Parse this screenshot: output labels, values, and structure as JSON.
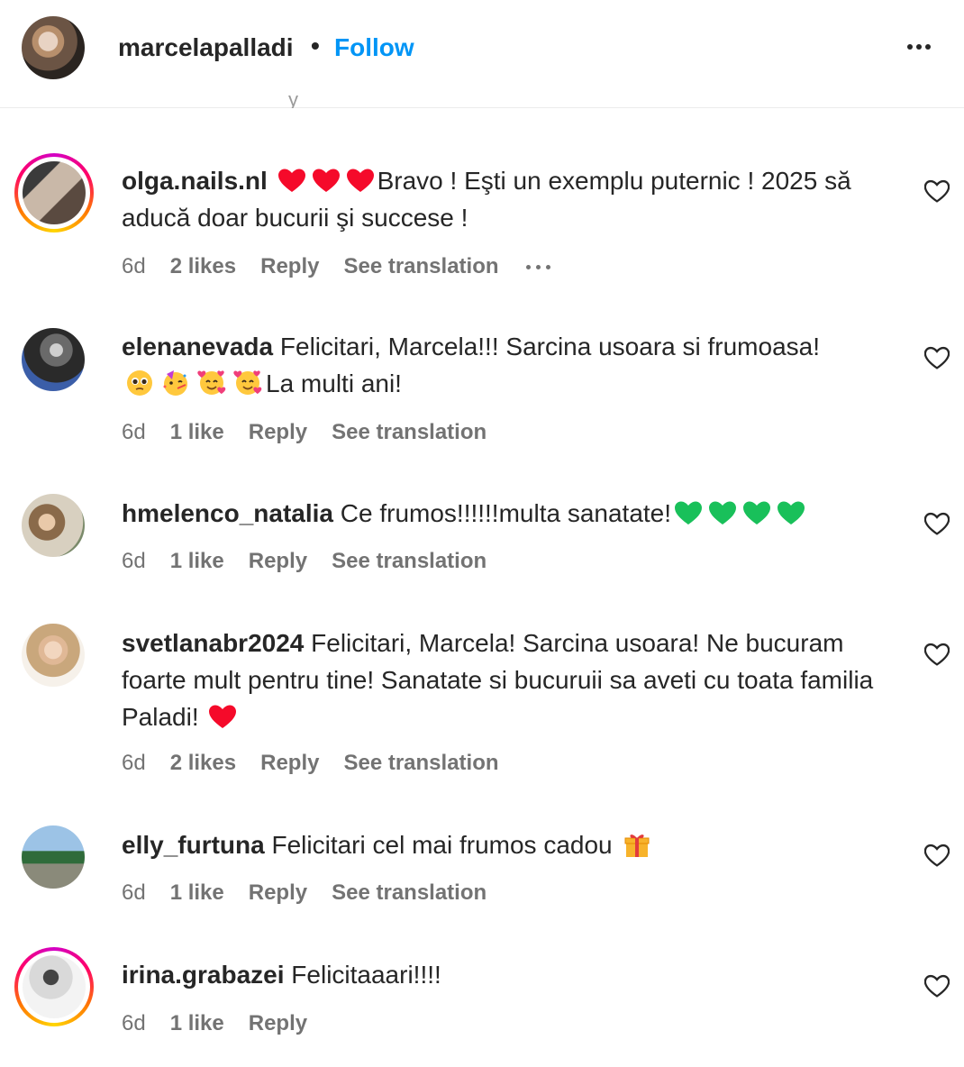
{
  "header": {
    "username": "marcelapalladi",
    "separator": "•",
    "follow_label": "Follow",
    "partial_text": "y"
  },
  "colors": {
    "link_blue": "#0095f6",
    "text_primary": "#262626",
    "text_secondary": "#737373",
    "heart_red": "#f50a2a",
    "heart_green": "#19c05a"
  },
  "comments": [
    {
      "username": "olga.nails.nl",
      "text": "Bravo ! Eşti un exemplu puternic ! 2025 să aducă doar bucurii şi succese !",
      "time": "6d",
      "likes": "2 likes",
      "reply": "Reply",
      "translation": "See translation",
      "emojis": [
        "red-heart",
        "red-heart",
        "red-heart"
      ]
    },
    {
      "username": "elenanevada",
      "text_a": "Felicitari, Marcela!!! Sarcina usoara si frumoasa!",
      "text_b": "La multi ani!",
      "time": "6d",
      "likes": "1 like",
      "reply": "Reply",
      "translation": "See translation",
      "emojis": [
        "pleading-face",
        "partying-face",
        "smiling-face-with-hearts",
        "smiling-face-with-hearts"
      ]
    },
    {
      "username": "hmelenco_natalia",
      "text": "Ce frumos!!!!!!multa sanatate!",
      "time": "6d",
      "likes": "1 like",
      "reply": "Reply",
      "translation": "See translation",
      "emojis": [
        "green-heart",
        "green-heart",
        "green-heart",
        "green-heart"
      ]
    },
    {
      "username": "svetlanabr2024",
      "text": "Felicitari, Marcela! Sarcina usoara! Ne bucuram foarte mult pentru tine! Sanatate si bucuruii sa aveti cu toata familia Paladi!",
      "time": "6d",
      "likes": "2 likes",
      "reply": "Reply",
      "translation": "See translation",
      "emojis": [
        "red-heart"
      ]
    },
    {
      "username": "elly_furtuna",
      "text": "Felicitari cel mai frumos cadou",
      "time": "6d",
      "likes": "1 like",
      "reply": "Reply",
      "translation": "See translation",
      "emojis": [
        "wrapped-gift"
      ]
    },
    {
      "username": "irina.grabazei",
      "text": "Felicitaaari!!!!",
      "time": "6d",
      "likes": "1 like",
      "reply": "Reply"
    }
  ]
}
